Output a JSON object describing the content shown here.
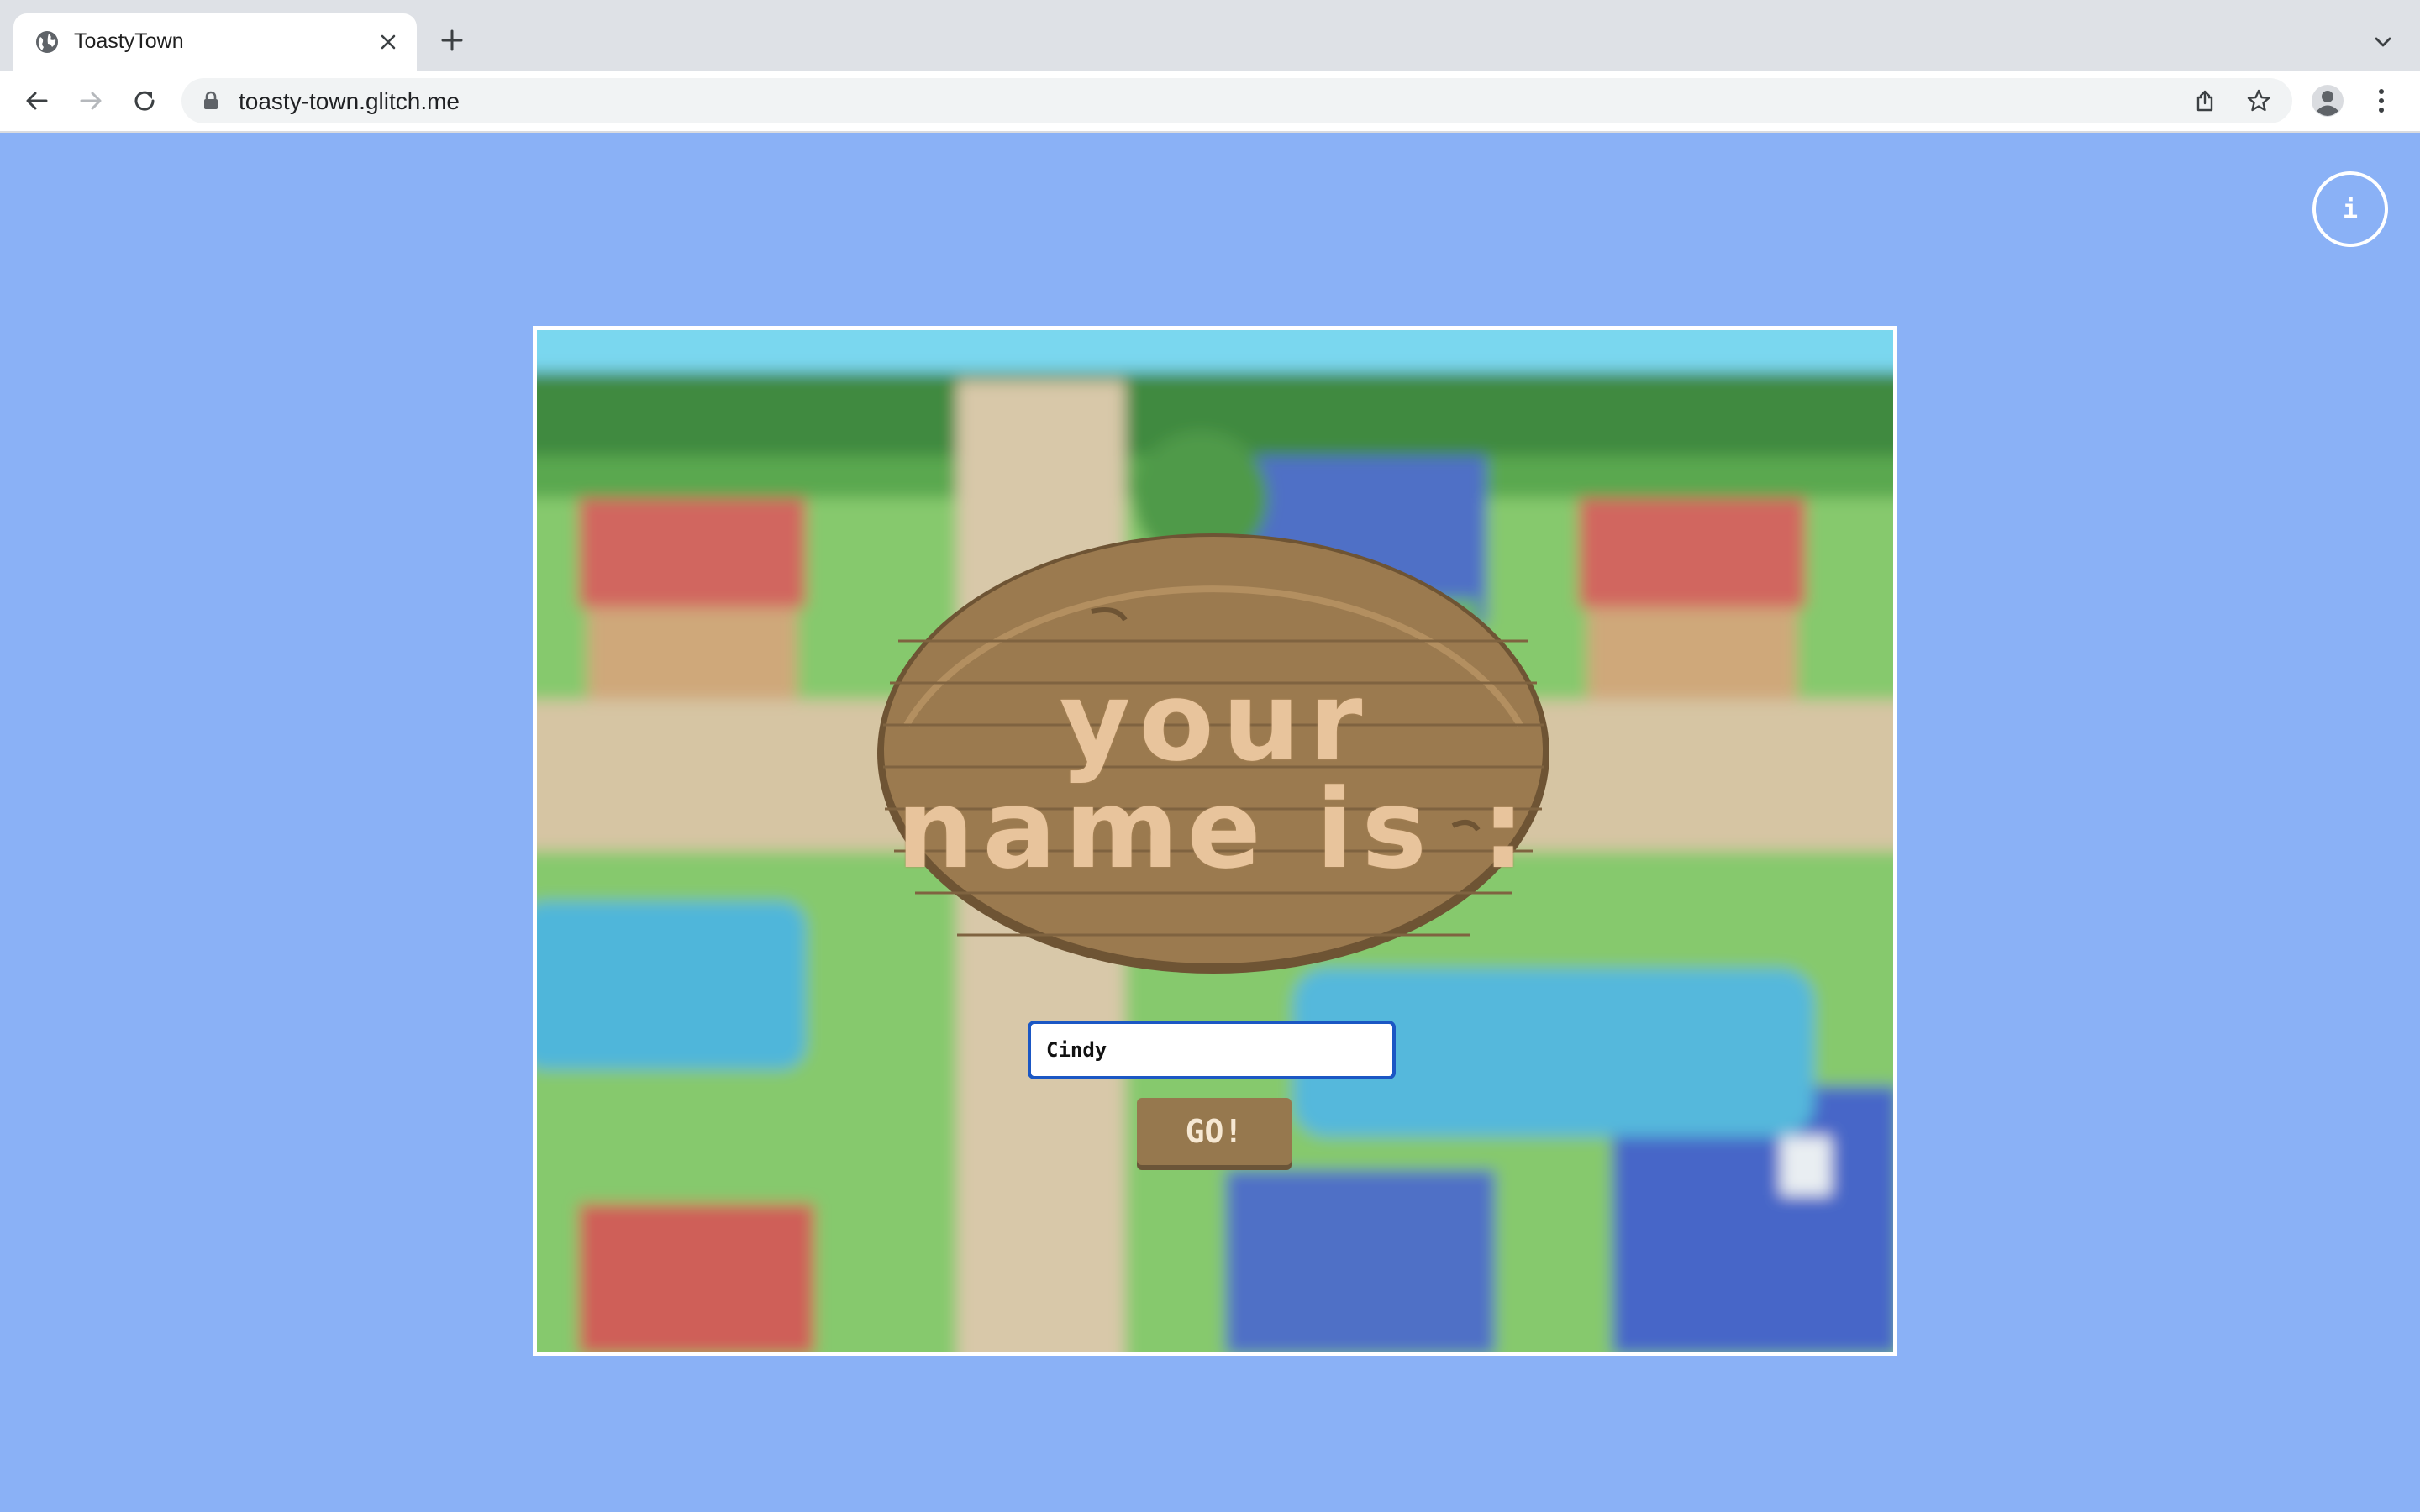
{
  "browser": {
    "tab": {
      "title": "ToastyTown",
      "favicon": "globe-icon"
    },
    "url": "toasty-town.glitch.me",
    "icons": {
      "back": "back-arrow-icon",
      "forward": "forward-arrow-icon",
      "reload": "reload-icon",
      "share": "share-icon",
      "bookmark": "star-icon",
      "profile": "profile-icon",
      "menu": "kebab-menu-icon"
    }
  },
  "page": {
    "background_color": "#8ab1f6",
    "info_button_label": "i",
    "sign": {
      "line1": "your",
      "line2": "name is :"
    },
    "name_input": {
      "value": "Cindy"
    },
    "go_button_label": "GO!"
  },
  "colors": {
    "sign_wood": "#9b7a4f",
    "sign_text": "#e8c49c",
    "input_border": "#1b57c4",
    "go_button": "#96784e"
  }
}
